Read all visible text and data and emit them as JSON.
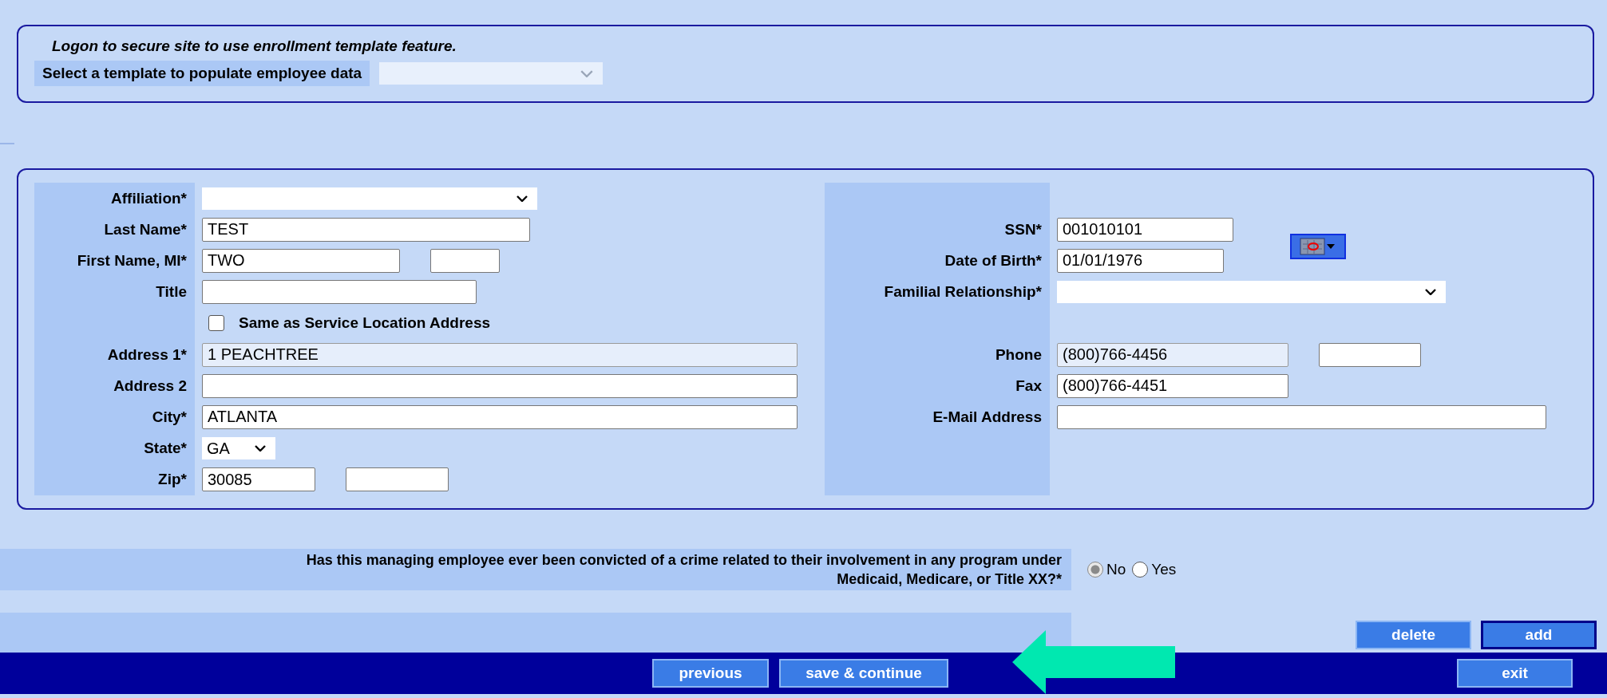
{
  "template_panel": {
    "notice": "Logon to secure site to use enrollment template feature.",
    "template_label": "Select a template to populate employee data"
  },
  "employee_form": {
    "left_fields": [
      {
        "kind": "select",
        "label": "Affiliation*"
      },
      {
        "kind": "text",
        "label": "Last Name*",
        "value": "TEST"
      },
      {
        "kind": "pair",
        "label": "First Name, MI*",
        "value": "TWO"
      },
      {
        "kind": "text",
        "label": "Title"
      },
      {
        "kind": "checkbox",
        "label": "Same as Service Location Address",
        "checked": false
      },
      {
        "kind": "text",
        "label": "Address 1*",
        "value": "1 PEACHTREE",
        "disabled": true
      },
      {
        "kind": "text",
        "label": "Address 2"
      },
      {
        "kind": "text",
        "label": "City*",
        "value": "ATLANTA"
      },
      {
        "kind": "select",
        "label": "State*",
        "value": "GA"
      },
      {
        "kind": "pair",
        "label": "Zip*",
        "value": "30085"
      }
    ],
    "right_fields": [
      {
        "kind": "blank"
      },
      {
        "kind": "text",
        "label": "SSN*",
        "value": "001010101"
      },
      {
        "kind": "date",
        "label": "Date of Birth*",
        "value": "01/01/1976"
      },
      {
        "kind": "select",
        "label": "Familial Relationship*"
      },
      {
        "kind": "blank"
      },
      {
        "kind": "pair",
        "label": "Phone",
        "value": "(800)766-4456",
        "disabled": true
      },
      {
        "kind": "text",
        "label": "Fax",
        "value": "(800)766-4451"
      },
      {
        "kind": "text",
        "label": "E-Mail Address"
      },
      {
        "kind": "blank"
      },
      {
        "kind": "blank"
      }
    ]
  },
  "question": {
    "text": "Has this managing employee ever been convicted of a crime related to their involvement in any program under\nMedicaid, Medicare, or Title XX?*",
    "options": [
      {
        "label": "No",
        "selected": true
      },
      {
        "label": "Yes",
        "selected": false
      }
    ]
  },
  "row_buttons": [
    {
      "label": "delete",
      "focused": false
    },
    {
      "label": "add",
      "focused": true
    }
  ],
  "footer_buttons": [
    {
      "label": "previous",
      "kind": "nav"
    },
    {
      "label": "save & continue",
      "kind": "nav"
    },
    {
      "label": "exit",
      "kind": "exit"
    }
  ]
}
